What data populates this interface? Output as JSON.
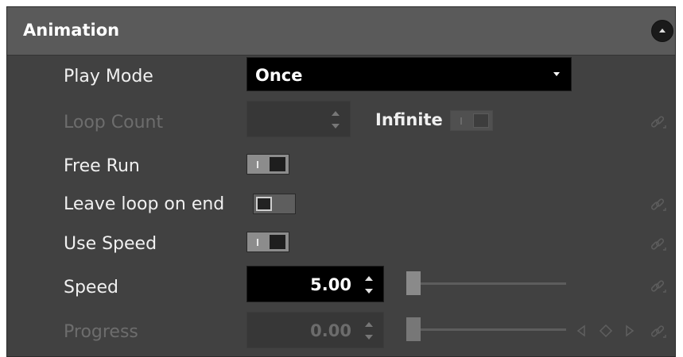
{
  "panel": {
    "title": "Animation",
    "collapse_icon": "chevron-up-icon"
  },
  "play_mode": {
    "label": "Play Mode",
    "value": "Once"
  },
  "loop_count": {
    "label": "Loop Count",
    "value": "",
    "infinite_label": "Infinite",
    "infinite_enabled": true
  },
  "free_run": {
    "label": "Free Run",
    "enabled": true
  },
  "leave_loop_on_end": {
    "label": "Leave loop on end",
    "enabled": false
  },
  "use_speed": {
    "label": "Use Speed",
    "enabled": true
  },
  "speed": {
    "label": "Speed",
    "value": "5.00",
    "slider_fraction": 0.0
  },
  "progress": {
    "label": "Progress",
    "value": "0.00",
    "slider_fraction": 0.0
  },
  "icons": {
    "link": "link-icon",
    "key_prev": "triangle-left-icon",
    "key_add": "diamond-icon",
    "key_next": "triangle-right-icon"
  },
  "colors": {
    "panel_bg": "#414141",
    "header_bg": "#5a5a5a",
    "field_bg": "#000000",
    "text": "#f0f0f0",
    "disabled_text": "#6d6d6d"
  }
}
